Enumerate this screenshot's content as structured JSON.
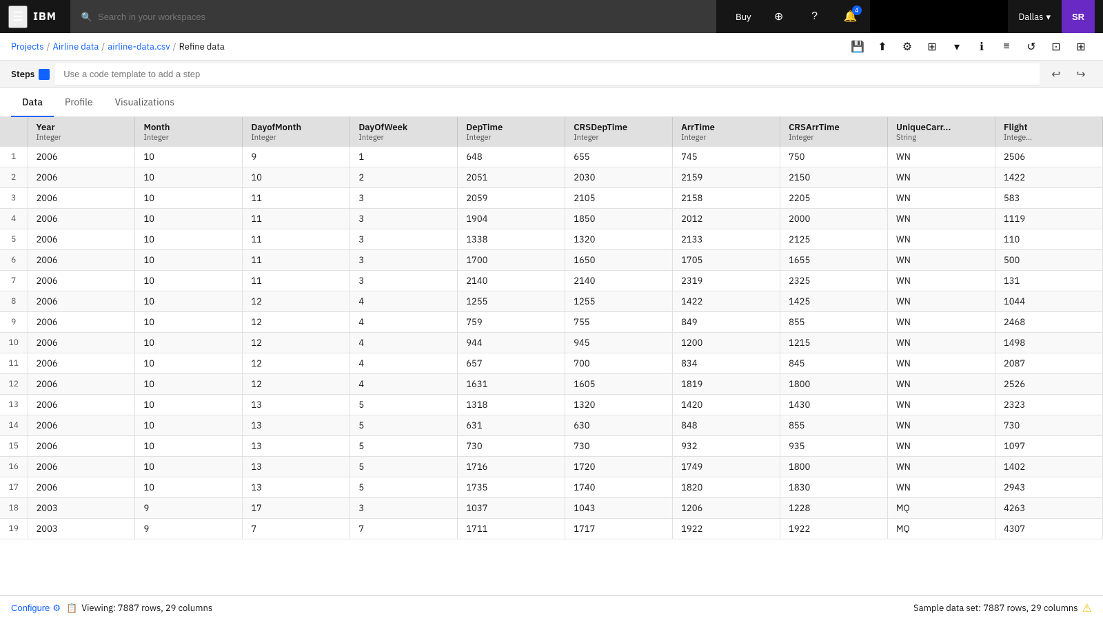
{
  "topnav": {
    "logo": "IBM",
    "search_placeholder": "Search in your workspaces",
    "buy_label": "Buy",
    "notifications_badge": "4",
    "location": "Dallas",
    "avatar": "SR"
  },
  "breadcrumb": {
    "items": [
      "Projects",
      "Airline data",
      "airline-data.csv",
      "Refine data"
    ],
    "separators": [
      "/",
      "/",
      "/"
    ]
  },
  "steps": {
    "label": "Steps",
    "input_placeholder": "Use a code template to add a step"
  },
  "tabs": [
    "Data",
    "Profile",
    "Visualizations"
  ],
  "active_tab": "Data",
  "table": {
    "columns": [
      {
        "name": "Year",
        "type": "Integer"
      },
      {
        "name": "Month",
        "type": "Integer"
      },
      {
        "name": "DayofMonth",
        "type": "Integer"
      },
      {
        "name": "DayOfWeek",
        "type": "Integer"
      },
      {
        "name": "DepTime",
        "type": "Integer"
      },
      {
        "name": "CRSDepTime",
        "type": "Integer"
      },
      {
        "name": "ArrTime",
        "type": "Integer"
      },
      {
        "name": "CRSArrTime",
        "type": "Integer"
      },
      {
        "name": "UniqueCarr...",
        "type": "String"
      },
      {
        "name": "Flight",
        "type": "Intege..."
      }
    ],
    "rows": [
      [
        1,
        2006,
        10,
        9,
        1,
        648,
        655,
        745,
        750,
        "WN",
        2506
      ],
      [
        2,
        2006,
        10,
        10,
        2,
        2051,
        2030,
        2159,
        2150,
        "WN",
        1422
      ],
      [
        3,
        2006,
        10,
        11,
        3,
        2059,
        2105,
        2158,
        2205,
        "WN",
        583
      ],
      [
        4,
        2006,
        10,
        11,
        3,
        1904,
        1850,
        2012,
        2000,
        "WN",
        1119
      ],
      [
        5,
        2006,
        10,
        11,
        3,
        1338,
        1320,
        2133,
        2125,
        "WN",
        110
      ],
      [
        6,
        2006,
        10,
        11,
        3,
        1700,
        1650,
        1705,
        1655,
        "WN",
        500
      ],
      [
        7,
        2006,
        10,
        11,
        3,
        2140,
        2140,
        2319,
        2325,
        "WN",
        131
      ],
      [
        8,
        2006,
        10,
        12,
        4,
        1255,
        1255,
        1422,
        1425,
        "WN",
        1044
      ],
      [
        9,
        2006,
        10,
        12,
        4,
        759,
        755,
        849,
        855,
        "WN",
        2468
      ],
      [
        10,
        2006,
        10,
        12,
        4,
        944,
        945,
        1200,
        1215,
        "WN",
        1498
      ],
      [
        11,
        2006,
        10,
        12,
        4,
        657,
        700,
        834,
        845,
        "WN",
        2087
      ],
      [
        12,
        2006,
        10,
        12,
        4,
        1631,
        1605,
        1819,
        1800,
        "WN",
        2526
      ],
      [
        13,
        2006,
        10,
        13,
        5,
        1318,
        1320,
        1420,
        1430,
        "WN",
        2323
      ],
      [
        14,
        2006,
        10,
        13,
        5,
        631,
        630,
        848,
        855,
        "WN",
        730
      ],
      [
        15,
        2006,
        10,
        13,
        5,
        730,
        730,
        932,
        935,
        "WN",
        1097
      ],
      [
        16,
        2006,
        10,
        13,
        5,
        1716,
        1720,
        1749,
        1800,
        "WN",
        1402
      ],
      [
        17,
        2006,
        10,
        13,
        5,
        1735,
        1740,
        1820,
        1830,
        "WN",
        2943
      ],
      [
        18,
        2003,
        9,
        17,
        3,
        1037,
        1043,
        1206,
        1228,
        "MQ",
        4263
      ],
      [
        19,
        2003,
        9,
        7,
        7,
        1711,
        1717,
        1922,
        1922,
        "MQ",
        4307
      ]
    ]
  },
  "status": {
    "configure_label": "Configure",
    "viewing_icon": "📋",
    "viewing_text": "Viewing:  7887 rows, 29 columns",
    "sample_label": "Sample data set:  7887 rows, 29 columns"
  }
}
